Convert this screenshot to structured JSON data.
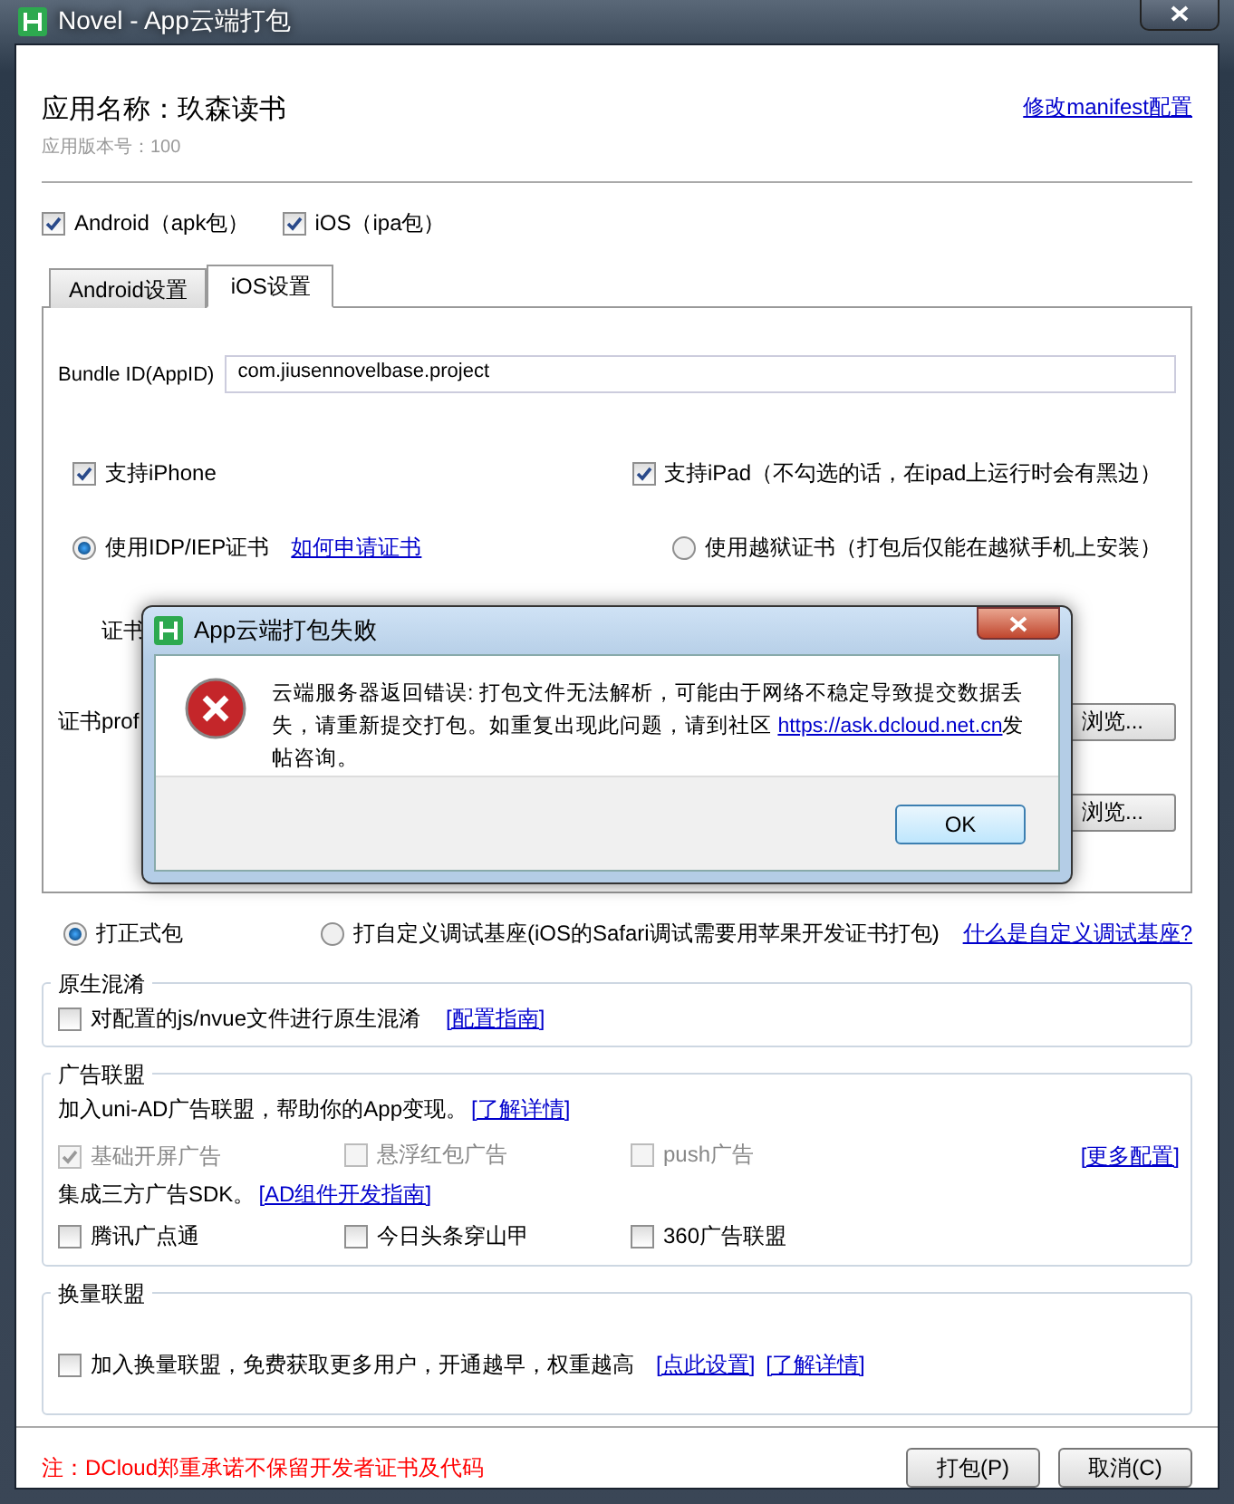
{
  "window": {
    "title": "Novel - App云端打包"
  },
  "app": {
    "name": "应用名称：玖森读书",
    "version": "应用版本号：100",
    "manifest_link": "修改manifest配置"
  },
  "platforms": [
    {
      "label": "Android（apk包）",
      "checked": true
    },
    {
      "label": "iOS（ipa包）",
      "checked": true
    }
  ],
  "tabs": [
    {
      "label": "Android设置",
      "selected": false
    },
    {
      "label": "iOS设置",
      "selected": true
    }
  ],
  "ios": {
    "bundle_label": "Bundle ID(AppID)",
    "bundle_value": "com.jiusennovelbase.project",
    "devices": [
      {
        "label": "支持iPhone",
        "checked": true
      },
      {
        "label": "支持iPad（不勾选的话，在ipad上运行时会有黑边）",
        "checked": true
      }
    ],
    "cert_types": [
      {
        "label": "使用IDP/IEP证书",
        "selected": true,
        "link": "如何申请证书"
      },
      {
        "label": "使用越狱证书（打包后仅能在越狱手机上安装）",
        "selected": false
      }
    ],
    "cert_rows": [
      {
        "label": "证书"
      },
      {
        "label": "证书prof",
        "button": "浏览..."
      },
      {
        "button": "浏览..."
      }
    ]
  },
  "build_types": [
    {
      "label": "打正式包",
      "selected": true
    },
    {
      "label": "打自定义调试基座(iOS的Safari调试需要用苹果开发证书打包)",
      "selected": false
    }
  ],
  "build_link": "什么是自定义调试基座?",
  "obfuscation": {
    "title": "原生混淆",
    "option": {
      "label": "对配置的js/nvue文件进行原生混淆",
      "checked": false
    },
    "link": "[配置指南]"
  },
  "ads": {
    "title": "广告联盟",
    "intro": "加入uni-AD广告联盟，帮助你的App变现。",
    "intro_link": "[了解详情]",
    "items": [
      {
        "label": "基础开屏广告",
        "checked": true,
        "disabled": true
      },
      {
        "label": "悬浮红包广告",
        "checked": false,
        "disabled": true
      },
      {
        "label": "push广告",
        "checked": false,
        "disabled": true
      }
    ],
    "more_link": "[更多配置]",
    "sdk_text": "集成三方广告SDK。",
    "sdk_link": "[AD组件开发指南]",
    "sdk_items": [
      {
        "label": "腾讯广点通",
        "checked": false
      },
      {
        "label": "今日头条穿山甲",
        "checked": false
      },
      {
        "label": "360广告联盟",
        "checked": false
      }
    ]
  },
  "exchange": {
    "title": "换量联盟",
    "option": {
      "label": "加入换量联盟，免费获取更多用户，开通越早，权重越高",
      "checked": false
    },
    "links": [
      "[点此设置]",
      "[了解详情]"
    ]
  },
  "note": "注：DCloud郑重承诺不保留开发者证书及代码",
  "buttons": [
    "打包(P)",
    "取消(C)"
  ],
  "dialog": {
    "title": "App云端打包失败",
    "message": "云端服务器返回错误: 打包文件无法解析，可能由于网络不稳定导致提交数据丢失，请重新提交打包。如重复出现此问题，请到社区 ",
    "link": "https://ask.dcloud.net.cn",
    "tail": "发帖咨询。",
    "ok": "OK"
  }
}
